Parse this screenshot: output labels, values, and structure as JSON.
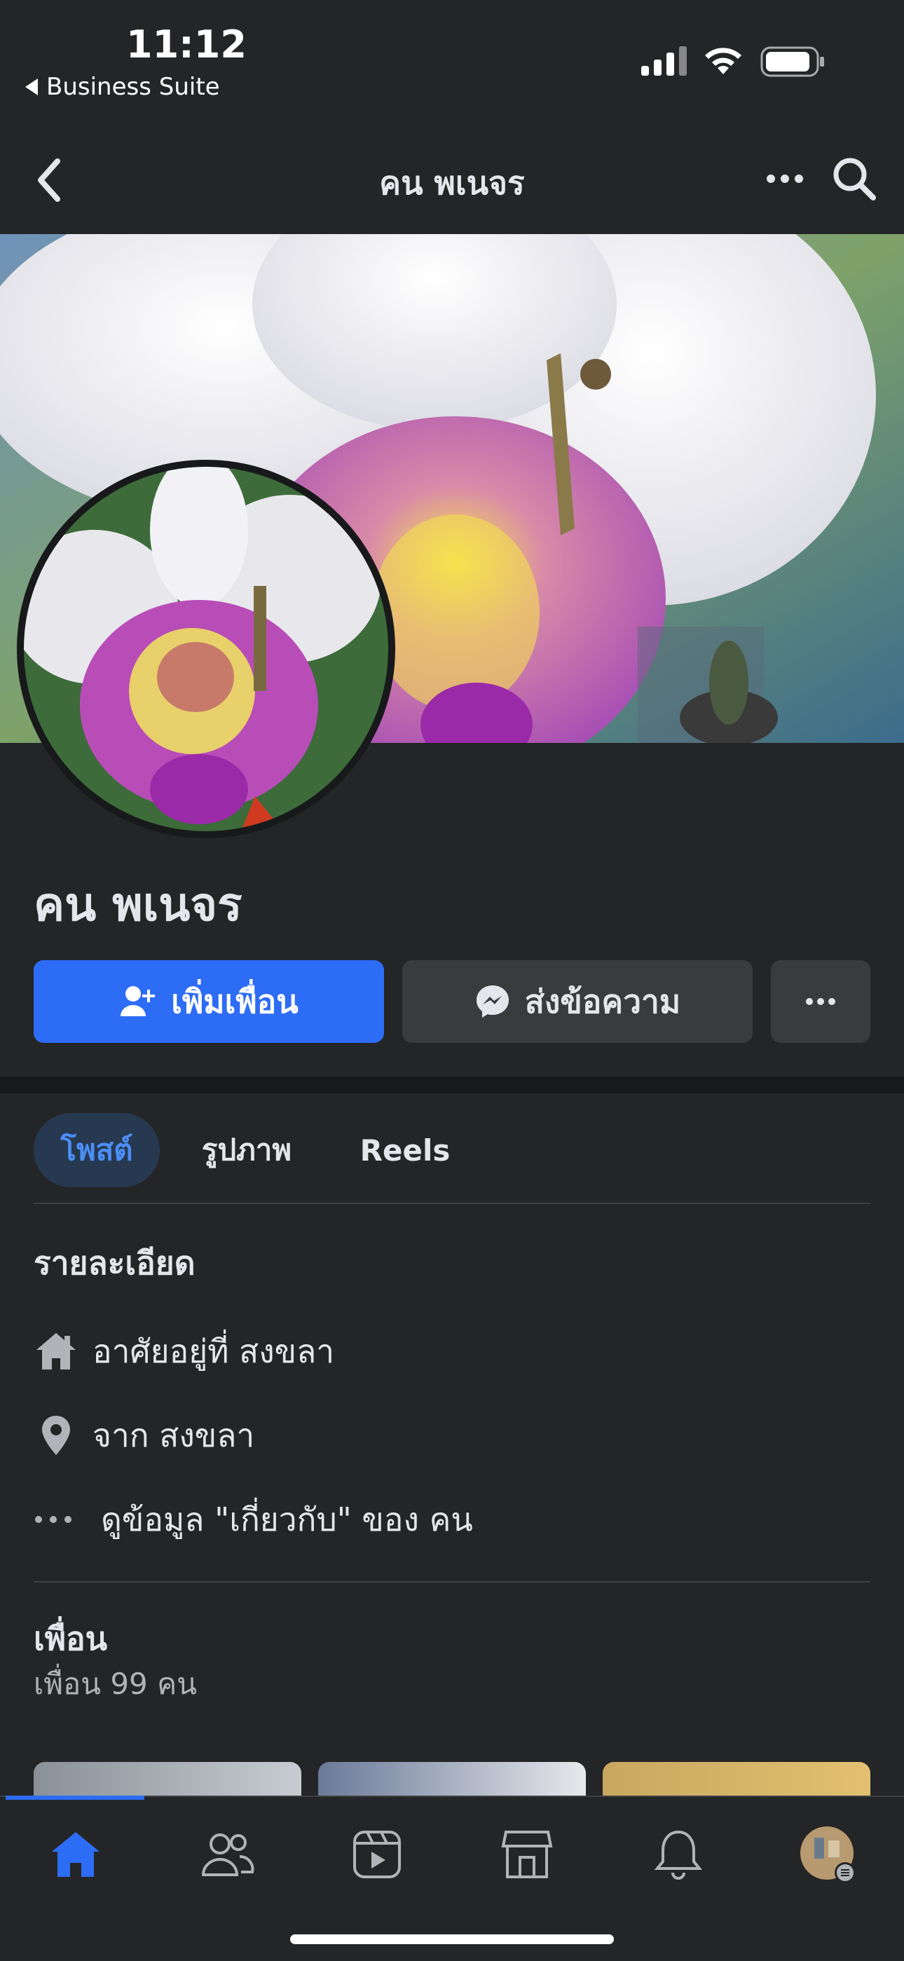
{
  "status_bar": {
    "time": "11:12",
    "back_app": "Business Suite",
    "icons": [
      "signal-icon",
      "wifi-icon",
      "battery-icon"
    ]
  },
  "nav": {
    "title": "คน พเนจร",
    "icons": [
      "back-chevron-icon",
      "more-icon",
      "search-icon"
    ]
  },
  "profile": {
    "name": "คน พเนจร"
  },
  "actions": {
    "add_friend": "เพิ่มเพื่อน",
    "message": "ส่งข้อความ",
    "more_icon": "more-icon"
  },
  "tabs": [
    {
      "label": "โพสต์",
      "active": true
    },
    {
      "label": "รูปภาพ",
      "active": false
    },
    {
      "label": "Reels",
      "active": false
    }
  ],
  "details": {
    "title": "รายละเอียด",
    "lives_in": "อาศัยอยู่ที่ สงขลา",
    "from": "จาก สงขลา",
    "about": "ดูข้อมูล \"เกี่ยวกับ\" ของ คน"
  },
  "friends": {
    "title": "เพื่อน",
    "count": "เพื่อน 99 คน"
  },
  "bottom_nav": [
    "home-icon",
    "friends-icon",
    "watch-icon",
    "marketplace-icon",
    "notifications-icon",
    "profile-menu-icon"
  ],
  "colors": {
    "background": "#242526",
    "accent": "#2d6cf5",
    "active_tab_bg": "#263951"
  }
}
